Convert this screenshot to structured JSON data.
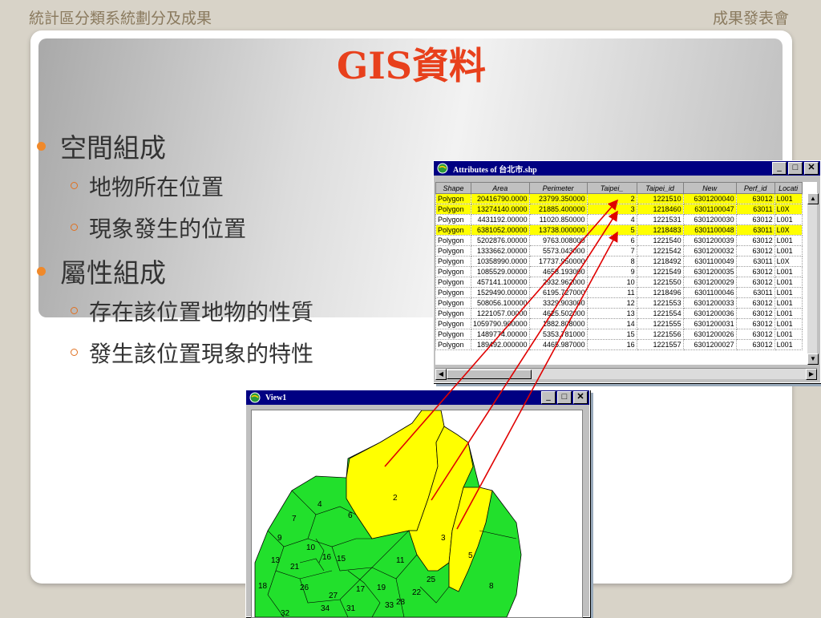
{
  "header": {
    "left": "統計區分類系統劃分及成果",
    "right": "成果發表會"
  },
  "title": "GIS資料",
  "bullets": {
    "b1": "空間組成",
    "b1a": "地物所在位置",
    "b1b": "現象發生的位置",
    "b2": "屬性組成",
    "b2a": "存在該位置地物的性質",
    "b2b": "發生該位置現象的特性"
  },
  "attr_window": {
    "title": "Attributes of 台北市.shp",
    "columns": [
      "Shape",
      "Area",
      "Perimeter",
      "Taipei_",
      "Taipei_id",
      "New",
      "Perf_id",
      "Locati"
    ],
    "rows": [
      {
        "selected": true,
        "cells": [
          "Polygon",
          "20416790.0000",
          "23799.350000",
          "2",
          "1221510",
          "6301200040",
          "63012",
          "L001"
        ]
      },
      {
        "selected": true,
        "cells": [
          "Polygon",
          "13274140.0000",
          "21885.400000",
          "3",
          "1218460",
          "6301100047",
          "63011",
          "L0X"
        ]
      },
      {
        "selected": false,
        "cells": [
          "Polygon",
          "4431192.00000",
          "11020.850000",
          "4",
          "1221531",
          "6301200030",
          "63012",
          "L001"
        ]
      },
      {
        "selected": true,
        "cells": [
          "Polygon",
          "6381052.00000",
          "13738.000000",
          "5",
          "1218483",
          "6301100048",
          "63011",
          "L0X"
        ]
      },
      {
        "selected": false,
        "cells": [
          "Polygon",
          "5202876.00000",
          "9763.008000",
          "6",
          "1221540",
          "6301200039",
          "63012",
          "L001"
        ]
      },
      {
        "selected": false,
        "cells": [
          "Polygon",
          "1333662.00000",
          "5573.043000",
          "7",
          "1221542",
          "6301200032",
          "63012",
          "L001"
        ]
      },
      {
        "selected": false,
        "cells": [
          "Polygon",
          "10358990.0000",
          "17737.950000",
          "8",
          "1218492",
          "6301100049",
          "63011",
          "L0X"
        ]
      },
      {
        "selected": false,
        "cells": [
          "Polygon",
          "1085529.00000",
          "4658.193000",
          "9",
          "1221549",
          "6301200035",
          "63012",
          "L001"
        ]
      },
      {
        "selected": false,
        "cells": [
          "Polygon",
          "457141.100000",
          "2932.962000",
          "10",
          "1221550",
          "6301200029",
          "63012",
          "L001"
        ]
      },
      {
        "selected": false,
        "cells": [
          "Polygon",
          "1529490.00000",
          "6195.727000",
          "11",
          "1218496",
          "6301100046",
          "63011",
          "L001"
        ]
      },
      {
        "selected": false,
        "cells": [
          "Polygon",
          "508056.100000",
          "3329.903000",
          "12",
          "1221553",
          "6301200033",
          "63012",
          "L001"
        ]
      },
      {
        "selected": false,
        "cells": [
          "Polygon",
          "1221057.00000",
          "4625.502000",
          "13",
          "1221554",
          "6301200036",
          "63012",
          "L001"
        ]
      },
      {
        "selected": false,
        "cells": [
          "Polygon",
          "1059790.900000",
          "1882.808000",
          "14",
          "1221555",
          "6301200031",
          "63012",
          "L001"
        ]
      },
      {
        "selected": false,
        "cells": [
          "Polygon",
          "1489774.00000",
          "5353.781000",
          "15",
          "1221556",
          "6301200026",
          "63012",
          "L001"
        ]
      },
      {
        "selected": false,
        "cells": [
          "Polygon",
          "189492.000000",
          "4465.987000",
          "16",
          "1221557",
          "6301200027",
          "63012",
          "L001"
        ]
      }
    ]
  },
  "view_window": {
    "title": "View1",
    "labels": [
      "2",
      "3",
      "5",
      "4",
      "6",
      "7",
      "8",
      "9",
      "10",
      "11",
      "13",
      "15",
      "16",
      "17",
      "18",
      "19",
      "21",
      "22",
      "25",
      "26",
      "27",
      "28",
      "31",
      "32",
      "33",
      "34"
    ]
  },
  "colors": {
    "title": "#e8401c",
    "selected_row": "#ffff00",
    "map_yellow": "#ffff00",
    "map_green": "#22e02c",
    "arrow": "#e00000",
    "titlebar": "#000082"
  }
}
